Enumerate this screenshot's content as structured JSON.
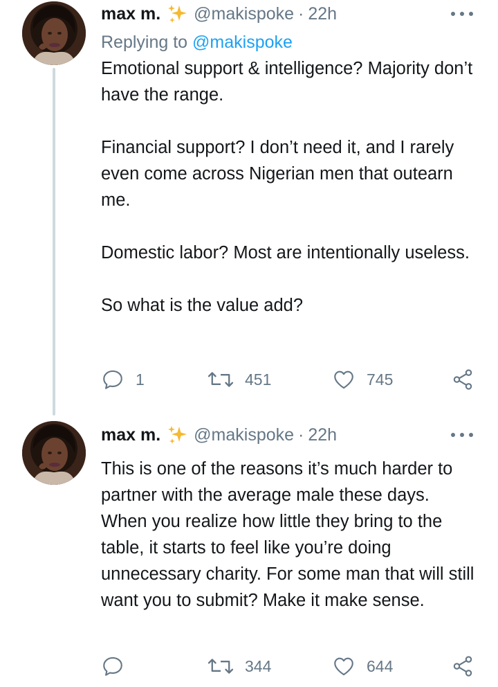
{
  "tweets": [
    {
      "author_name": "max m.",
      "handle": "@makispoke",
      "separator": "·",
      "time": "22h",
      "reply_prefix": "Replying to ",
      "reply_to": "@makispoke",
      "paragraphs": [
        "Emotional support & intelligence? Majority don’t have the range.",
        "Financial support? I don’t need it, and I rarely even come across Nigerian men that outearn me.",
        "Domestic labor? Most are intentionally useless.",
        "So what is the value add?"
      ],
      "reply_count": "1",
      "retweet_count": "451",
      "like_count": "745"
    },
    {
      "author_name": "max m.",
      "handle": "@makispoke",
      "separator": "·",
      "time": "22h",
      "paragraphs": [
        "This is one of the reasons it’s much harder to partner with the average male these days. When you realize how little they bring to the table, it starts to feel like you’re doing unnecessary charity. For some man that will still want you to submit? Make it make sense."
      ],
      "reply_count": "",
      "retweet_count": "344",
      "like_count": "644"
    }
  ],
  "icons": {
    "badge": "sparkles-emoji",
    "more": "more-horizontal-icon",
    "reply": "reply-bubble-icon",
    "retweet": "retweet-icon",
    "like": "heart-icon",
    "share": "share-icon"
  },
  "colors": {
    "text": "#14171a",
    "muted": "#657786",
    "link": "#1da1f2",
    "thread_line": "#cfd9de",
    "sparkle": "#f5b932"
  }
}
